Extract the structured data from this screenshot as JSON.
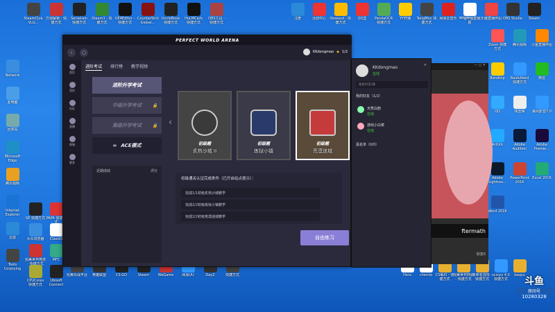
{
  "desktop": {
    "left_icons": [
      {
        "label": "SteamClub VLG...",
        "color": "#444"
      },
      {
        "label": "方便解锁 - 快捷方式",
        "color": "#c33"
      },
      {
        "label": "Serialrain 快捷方式",
        "color": "#222"
      },
      {
        "label": "Steam1 - 快捷方式",
        "color": "#383"
      },
      {
        "label": "UE4Editor - 快捷方式",
        "color": "#111"
      },
      {
        "label": "CounterStrike Global...",
        "color": "#811"
      },
      {
        "label": "UncleBook 快捷方式",
        "color": "#222"
      },
      {
        "label": "HuLMCarb 快捷方式",
        "color": "#111"
      },
      {
        "label": "OBS工具 - 快捷方式",
        "color": "#a44"
      }
    ],
    "col_icons": [
      {
        "label": "Network",
        "color": "#3a8ee0"
      },
      {
        "label": "此电脑",
        "color": "#4a9ee8"
      },
      {
        "label": "回收站",
        "color": "#7aa"
      },
      {
        "label": "Microsoft Edge",
        "color": "#1e90c8"
      },
      {
        "label": "腾讯视频",
        "color": "#e8a020"
      },
      {
        "label": "Internet Explorer",
        "color": "#1a74d6"
      },
      {
        "label": "迅雷",
        "color": "#2b8ad8"
      },
      {
        "label": "Tools Corptylng",
        "color": "#444"
      }
    ],
    "col2_icons": [
      {
        "label": "SE 快捷方式",
        "color": "#222"
      },
      {
        "label": "大众浏览器",
        "color": "#3a8ee0"
      },
      {
        "label": "完美世界竞技 - 快捷方式",
        "color": "#c33"
      },
      {
        "label": "CPUCores 快捷方式",
        "color": "#aa3"
      }
    ],
    "col3_icons": [
      {
        "label": "PAPA 快捷方式",
        "color": "#d33"
      },
      {
        "label": "ClassIO",
        "color": "#fff"
      },
      {
        "label": "MFC",
        "color": "#3a8"
      },
      {
        "label": "Ubisoft Connect",
        "color": "#222"
      }
    ],
    "top_right_icons": [
      {
        "label": "注册",
        "color": "#2b8ad8"
      },
      {
        "label": "活动中心",
        "color": "#e33"
      },
      {
        "label": "Nowasd - 快捷方式",
        "color": "#fb0"
      },
      {
        "label": "QQ堂",
        "color": "#e33"
      },
      {
        "label": "PandaOCR 快捷方式",
        "color": "#5a5"
      },
      {
        "label": "YY开播",
        "color": "#fc0"
      },
      {
        "label": "TengMon 快捷方式",
        "color": "#444"
      },
      {
        "label": "网易云音乐",
        "color": "#d22"
      },
      {
        "label": "哔哩哔哩直播姬",
        "color": "#fff"
      },
      {
        "label": "乐趣直播伴侣",
        "color": "#e44"
      },
      {
        "label": "OBS Studio",
        "color": "#333"
      },
      {
        "label": "Steam",
        "color": "#222"
      }
    ],
    "right_col_icons": [
      {
        "label": "Zoom 快捷方式",
        "color": "#f55"
      },
      {
        "label": "腾讯视频",
        "color": "#29b"
      },
      {
        "label": "斗鱼直播伴侣",
        "color": "#f80"
      },
      {
        "label": "Bandizip",
        "color": "#fc0"
      },
      {
        "label": "BaiduNetd 快捷方式",
        "color": "#39f"
      },
      {
        "label": "微信",
        "color": "#2b2"
      },
      {
        "label": "QQ",
        "color": "#3af"
      },
      {
        "label": "快剪辑",
        "color": "#eee"
      },
      {
        "label": "暴风影音7.0",
        "color": "#39f"
      },
      {
        "label": "ArtUrk",
        "color": "#2af"
      },
      {
        "label": "Adobe Audition",
        "color": "#0a1a3a"
      },
      {
        "label": "Adobe Premie...",
        "color": "#1a0a3a"
      },
      {
        "label": "Adobe Lightroo...",
        "color": "#0a1a2a"
      },
      {
        "label": "PowerPoint 2016",
        "color": "#c43"
      },
      {
        "label": "Excel 2016",
        "color": "#2a7"
      },
      {
        "label": "Word 2016",
        "color": "#25a"
      }
    ],
    "bottom_icons": [
      {
        "label": "完美对战平台",
        "color": "#444"
      },
      {
        "label": "英雄联盟",
        "color": "#333"
      },
      {
        "label": "CS:GO",
        "color": "#222"
      },
      {
        "label": "Steam",
        "color": "#222"
      },
      {
        "label": "WeGame",
        "color": "#c33"
      },
      {
        "label": "网易UU",
        "color": "#39f"
      },
      {
        "label": "DayZ",
        "color": "#333"
      },
      {
        "label": "快捷方式",
        "color": "#444"
      }
    ],
    "bottom_right_icons": [
      {
        "label": "Hera",
        "color": "#fff"
      },
      {
        "label": "chemio",
        "color": "#fff"
      },
      {
        "label": "CS每日 - 快捷方式",
        "color": "#e8b030"
      },
      {
        "label": "完美世界商城 - 快捷方式",
        "color": "#e8b030"
      },
      {
        "label": "未命名选项 - 快捷方式",
        "color": "#e8b030"
      },
      {
        "label": "scrcpy 4.0 快捷方式",
        "color": "#39f"
      },
      {
        "label": "kaopu",
        "color": "#e8b030"
      }
    ]
  },
  "window": {
    "title": "PERFECT WORLD ARENA",
    "user": "KKdongmao",
    "sidebar": [
      "首页",
      "竞技",
      "社区",
      "直播",
      "商城",
      "更多"
    ],
    "tabs": [
      "进阶考试",
      "排行榜",
      "教学视频"
    ],
    "modes": [
      {
        "label": "进阶升学考试",
        "state": "active"
      },
      {
        "label": "中级升学考试",
        "state": "locked"
      },
      {
        "label": "高级升学考试",
        "state": "locked"
      },
      {
        "label": "ACE模式",
        "state": "dark"
      }
    ],
    "history_label": "近期成绩",
    "history_more": "评分",
    "maps": [
      {
        "difficulty": "初级题",
        "name": "炙热沙城 II",
        "badge_color": "#3a3a3a"
      },
      {
        "difficulty": "初级题",
        "name": "炼狱小镇",
        "badge_color": "#2a3a6a"
      },
      {
        "difficulty": "初级题",
        "name": "荒漠迷城",
        "badge_color": "#c53a3a"
      }
    ],
    "requirement_title": "初级通关认证完成条件（已开启站点提示）：",
    "tasks": [
      "完成1/1初级炙热沙城教学",
      "完成2/2初级炼狱小镇教学",
      "完成2/2初级荒漠迷城教学"
    ],
    "practice_button": "自由练习",
    "page_indicator": "1/2"
  },
  "friends": {
    "user": "KKdongmao",
    "status": "在线",
    "search_placeholder": "搜索好友/群",
    "my_friends": "我的好友（1/2）",
    "friend_list": [
      {
        "name": "天秀白鹤",
        "status": "在线"
      },
      {
        "name": "游戏小白菜",
        "status": "在线"
      }
    ],
    "blacklist": "黑名单（0/0）"
  },
  "side_window": {
    "text": "ftermath",
    "corner": "好友5"
  },
  "watermark": {
    "line1": "斗鱼",
    "line2": "房间号",
    "line3": "10280328"
  }
}
